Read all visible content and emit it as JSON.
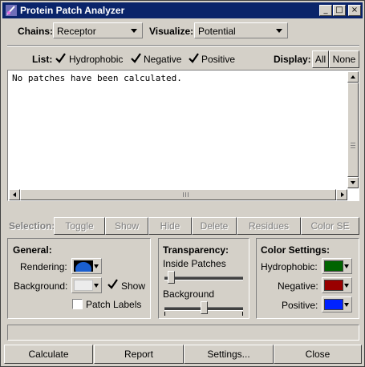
{
  "window": {
    "title": "Protein Patch Analyzer",
    "min_glyph": "_",
    "max_glyph": "□",
    "close_glyph": "×"
  },
  "chains": {
    "label": "Chains:",
    "value": "Receptor"
  },
  "visualize": {
    "label": "Visualize:",
    "value": "Potential"
  },
  "list": {
    "label": "List:",
    "options": [
      {
        "label": "Hydrophobic",
        "checked": true
      },
      {
        "label": "Negative",
        "checked": true
      },
      {
        "label": "Positive",
        "checked": true
      }
    ]
  },
  "display": {
    "label": "Display:",
    "all": "All",
    "none": "None"
  },
  "output": {
    "text": "No patches have been calculated."
  },
  "selection": {
    "label": "Selection:",
    "buttons": [
      "Toggle",
      "Show",
      "Hide",
      "Delete",
      "Residues",
      "Color SE"
    ]
  },
  "general": {
    "title": "General:",
    "rendering_label": "Rendering:",
    "background_label": "Background:",
    "show_label": "Show",
    "show_checked": true,
    "patch_labels_label": "Patch Labels",
    "patch_labels_checked": false,
    "rendering_color": "#1a5fd0",
    "background_color": "#ececec"
  },
  "transparency": {
    "title": "Transparency:",
    "inside_label": "Inside Patches",
    "inside_value": 0.05,
    "background_label": "Background",
    "background_value": 0.5
  },
  "color_settings": {
    "title": "Color Settings:",
    "hydrophobic_label": "Hydrophobic:",
    "hydrophobic_color": "#006400",
    "negative_label": "Negative:",
    "negative_color": "#990000",
    "positive_label": "Positive:",
    "positive_color": "#0022ff"
  },
  "footer": {
    "calculate": "Calculate",
    "report": "Report",
    "settings": "Settings...",
    "close": "Close"
  }
}
